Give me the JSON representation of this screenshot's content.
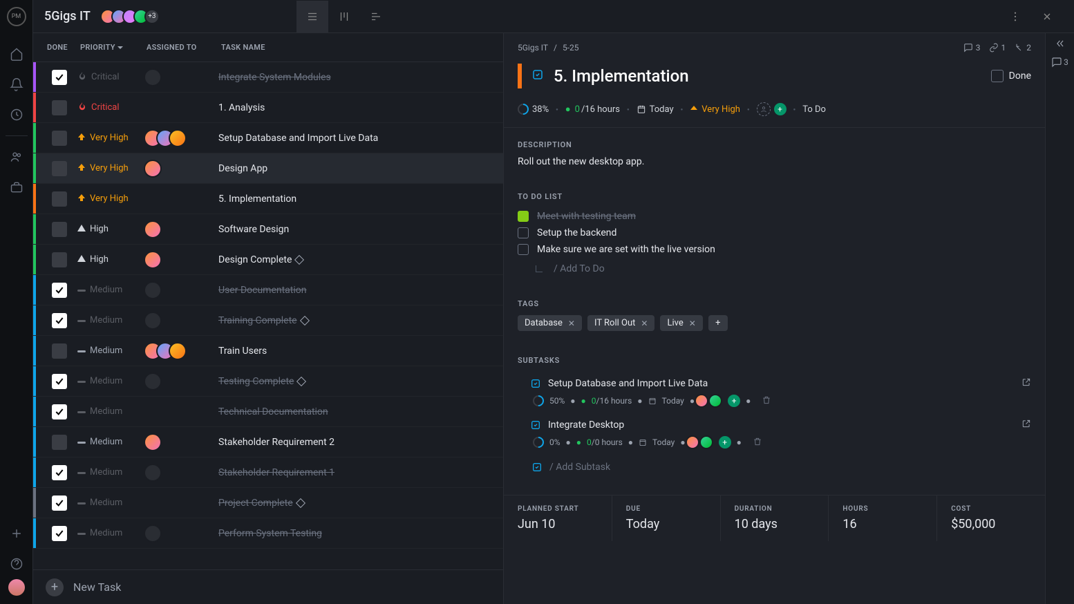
{
  "header": {
    "project_name": "5Gigs IT",
    "avatar_more": "+3"
  },
  "columns": {
    "done": "DONE",
    "priority": "PRIORITY",
    "assigned": "ASSIGNED TO",
    "task": "TASK NAME"
  },
  "newtask_label": "New Task",
  "tasks": [
    {
      "done": true,
      "priority": "Critical",
      "pclass": "critical done-style",
      "picon": "flame",
      "barcolor": "#a855f7",
      "done_style": true,
      "name": "Integrate System Modules",
      "av": "ghost"
    },
    {
      "done": false,
      "priority": "Critical",
      "pclass": "critical",
      "picon": "flame",
      "barcolor": "#ef4444",
      "done_style": false,
      "name": "1. Analysis"
    },
    {
      "done": false,
      "priority": "Very High",
      "pclass": "veryhigh",
      "picon": "up",
      "barcolor": "#22c55e",
      "done_style": false,
      "name": "Setup Database and Import Live Data",
      "av": "multi"
    },
    {
      "done": false,
      "priority": "Very High",
      "pclass": "veryhigh",
      "picon": "up",
      "barcolor": "#22c55e",
      "done_style": false,
      "name": "Design App",
      "av": "one",
      "selected": true
    },
    {
      "done": false,
      "priority": "Very High",
      "pclass": "veryhigh",
      "picon": "up",
      "barcolor": "#f97316",
      "done_style": false,
      "name": "5. Implementation"
    },
    {
      "done": false,
      "priority": "High",
      "pclass": "high",
      "picon": "tri",
      "barcolor": "#22c55e",
      "done_style": false,
      "name": "Software Design",
      "av": "one"
    },
    {
      "done": false,
      "priority": "High",
      "pclass": "high",
      "picon": "tri",
      "barcolor": "#22c55e",
      "done_style": false,
      "name": "Design Complete",
      "av": "one",
      "milestone": true
    },
    {
      "done": true,
      "priority": "Medium",
      "pclass": "medium",
      "picon": "dash",
      "barcolor": "#0ea5e9",
      "done_style": true,
      "name": "User Documentation",
      "av": "ghost"
    },
    {
      "done": true,
      "priority": "Medium",
      "pclass": "medium",
      "picon": "dash",
      "barcolor": "#0ea5e9",
      "done_style": true,
      "name": "Training Complete",
      "av": "ghost",
      "milestone": true
    },
    {
      "done": false,
      "priority": "Medium",
      "pclass": "medium",
      "picon": "dash",
      "barcolor": "#0ea5e9",
      "done_style": false,
      "name": "Train Users",
      "av": "multi"
    },
    {
      "done": true,
      "priority": "Medium",
      "pclass": "medium",
      "picon": "dash",
      "barcolor": "#0ea5e9",
      "done_style": true,
      "name": "Testing Complete",
      "av": "ghost",
      "milestone": true
    },
    {
      "done": true,
      "priority": "Medium",
      "pclass": "medium",
      "picon": "dash",
      "barcolor": "#0ea5e9",
      "done_style": true,
      "name": "Technical Documentation"
    },
    {
      "done": false,
      "priority": "Medium",
      "pclass": "medium",
      "picon": "dash",
      "barcolor": "#0ea5e9",
      "done_style": false,
      "name": "Stakeholder Requirement 2",
      "av": "one"
    },
    {
      "done": true,
      "priority": "Medium",
      "pclass": "medium",
      "picon": "dash",
      "barcolor": "#0ea5e9",
      "done_style": true,
      "name": "Stakeholder Requirement 1",
      "av": "ghost"
    },
    {
      "done": true,
      "priority": "Medium",
      "pclass": "medium",
      "picon": "dash",
      "barcolor": "#6b7280",
      "done_style": true,
      "name": "Project Complete",
      "milestone": true
    },
    {
      "done": true,
      "priority": "Medium",
      "pclass": "medium",
      "picon": "dash",
      "barcolor": "#0ea5e9",
      "done_style": true,
      "name": "Perform System Testing",
      "av": "ghost"
    }
  ],
  "detail": {
    "breadcrumb": {
      "proj": "5Gigs IT",
      "id": "5-25"
    },
    "counts": {
      "comments": "3",
      "links": "1",
      "subtasks": "2"
    },
    "title": "5. Implementation",
    "done_label": "Done",
    "meta": {
      "pct": "38%",
      "hrs_used": "0",
      "hrs_total": "/16 hours",
      "date": "Today",
      "priority": "Very High",
      "status": "To Do"
    },
    "desc_h": "DESCRIPTION",
    "desc": "Roll out the new desktop app.",
    "todo_h": "TO DO LIST",
    "todos": [
      {
        "done": true,
        "text": "Meet with testing team"
      },
      {
        "done": false,
        "text": "Setup the backend"
      },
      {
        "done": false,
        "text": "Make sure we are set with the live version"
      }
    ],
    "todo_add": "/ Add To Do",
    "tags_h": "TAGS",
    "tags": [
      "Database",
      "IT Roll Out",
      "Live"
    ],
    "subtasks_h": "SUBTASKS",
    "subtasks": [
      {
        "name": "Setup Database and Import Live Data",
        "pct": "50%",
        "hrs_used": "0",
        "hrs_total": "/16 hours",
        "date": "Today"
      },
      {
        "name": "Integrate Desktop",
        "pct": "0%",
        "hrs_used": "0",
        "hrs_total": "/0 hours",
        "date": "Today"
      }
    ],
    "subtask_add": "/ Add Subtask",
    "footer": {
      "start_h": "PLANNED START",
      "start": "Jun 10",
      "due_h": "DUE",
      "due": "Today",
      "dur_h": "DURATION",
      "dur": "10 days",
      "hrs_h": "HOURS",
      "hrs": "16",
      "cost_h": "COST",
      "cost": "$50,000"
    }
  },
  "strip": {
    "comments": "3"
  }
}
